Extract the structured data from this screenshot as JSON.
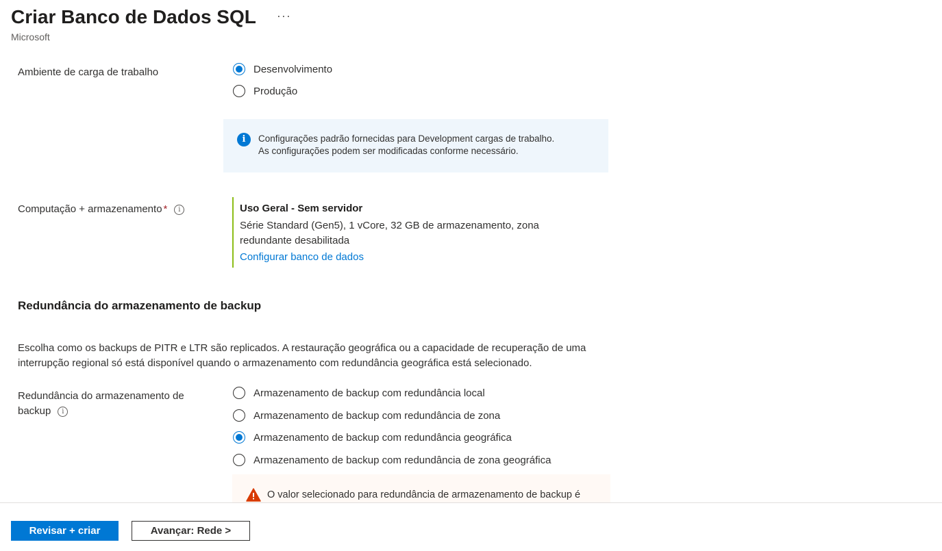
{
  "header": {
    "title": "Criar Banco de Dados SQL",
    "more_label": "···",
    "subtitle": "Microsoft"
  },
  "workload": {
    "label": "Ambiente de carga de trabalho",
    "options": [
      {
        "label": "Desenvolvimento",
        "checked": true
      },
      {
        "label": "Produção",
        "checked": false
      }
    ],
    "info_line1": "Configurações padrão fornecidas para Development cargas de trabalho.",
    "info_line2": "As configurações podem ser modificadas conforme necessário."
  },
  "compute": {
    "label": "Computação + armazenamento",
    "required_mark": "*",
    "tier": "Uso Geral - Sem servidor",
    "description": "Série Standard (Gen5), 1 vCore, 32 GB de armazenamento, zona redundante desabilitada",
    "link": "Configurar banco de dados"
  },
  "backup": {
    "heading": "Redundância do armazenamento de backup",
    "description": "Escolha como os backups de PITR e LTR são replicados. A restauração geográfica ou a capacidade de recuperação de uma interrupção regional só está disponível quando o armazenamento com redundância geográfica está selecionado.",
    "label_line1": "Redundância do armazenamento de",
    "label_line2": "backup",
    "options": [
      {
        "label": "Armazenamento de backup com redundância local",
        "checked": false
      },
      {
        "label": "Armazenamento de backup com redundância de zona",
        "checked": false
      },
      {
        "label": "Armazenamento de backup com redundância geográfica",
        "checked": true
      },
      {
        "label": "Armazenamento de backup com redundância de zona geográfica",
        "checked": false
      }
    ],
    "warning": "O valor selecionado para redundância de armazenamento de backup é"
  },
  "footer": {
    "primary": "Revisar + criar",
    "secondary": "Avançar: Rede >"
  },
  "colors": {
    "accent": "#0078d4",
    "compute_border": "#8cbd18",
    "warning": "#d83b01"
  },
  "icons": {
    "info": "i",
    "tooltip": "i"
  }
}
